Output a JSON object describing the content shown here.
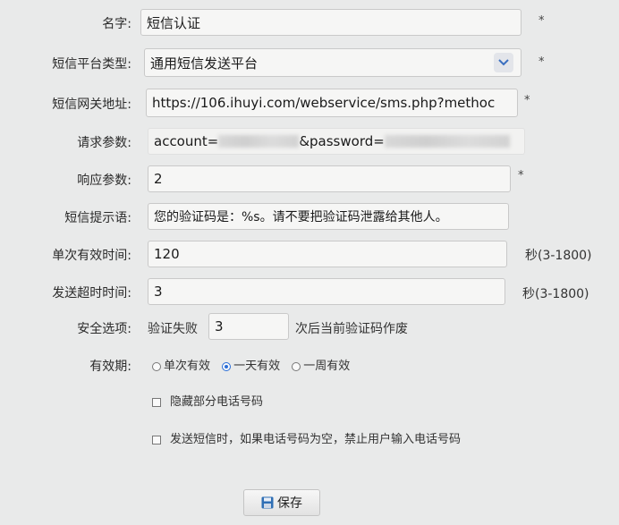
{
  "form": {
    "name": {
      "label": "名字:",
      "value": "短信认证",
      "required": "*"
    },
    "platform_type": {
      "label": "短信平台类型:",
      "value": "通用短信发送平台",
      "required": "*"
    },
    "gateway": {
      "label": "短信网关地址:",
      "value": "https://106.ihuyi.com/webservice/sms.php?methoc",
      "required": "*"
    },
    "request_params": {
      "label": "请求参数:",
      "value_prefix": "account=",
      "value_mid": "&password="
    },
    "response_params": {
      "label": "响应参数:",
      "value": "2",
      "required": "*"
    },
    "sms_prompt": {
      "label": "短信提示语:",
      "value": "您的验证码是：%s。请不要把验证码泄露给其他人。"
    },
    "valid_time": {
      "label": "单次有效时间:",
      "value": "120",
      "unit": "秒(3-1800)"
    },
    "timeout": {
      "label": "发送超时时间:",
      "value": "3",
      "unit": "秒(3-1800)"
    },
    "security": {
      "label": "安全选项:",
      "prefix": "验证失败",
      "value": "3",
      "suffix": "次后当前验证码作废"
    },
    "validity": {
      "label": "有效期:",
      "options": [
        "单次有效",
        "一天有效",
        "一周有效"
      ],
      "selected": "一天有效"
    },
    "hide_phone": {
      "label": "隐藏部分电话号码",
      "checked": false
    },
    "block_empty_phone": {
      "label": "发送短信时，如果电话号码为空，禁止用户输入电话号码",
      "checked": false
    }
  },
  "actions": {
    "save_label": "保存"
  },
  "colors": {
    "background": "#e9eaea",
    "radio_accent": "#2a6ed8",
    "save_icon": "#2f6fb5"
  }
}
